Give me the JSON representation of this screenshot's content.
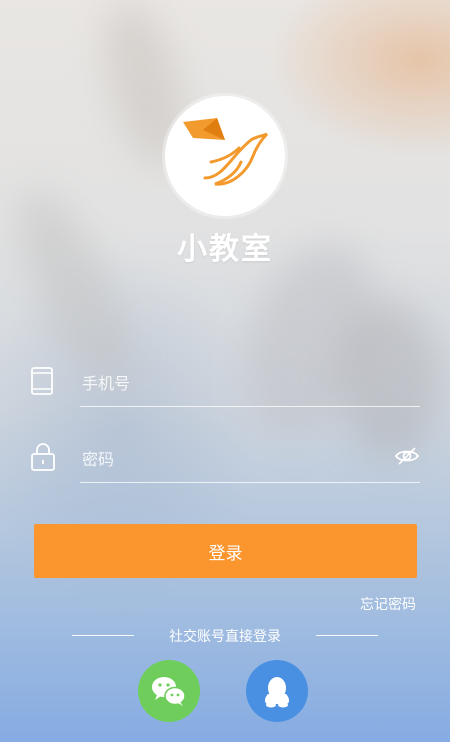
{
  "app": {
    "name": "小教室"
  },
  "form": {
    "phone_placeholder": "手机号",
    "password_placeholder": "密码",
    "login_label": "登录",
    "forgot_label": "忘记密码"
  },
  "social": {
    "label": "社交账号直接登录",
    "providers": [
      {
        "name": "wechat",
        "icon": "wechat-icon",
        "color": "#6fce5b"
      },
      {
        "name": "qq",
        "icon": "qq-icon",
        "color": "#4a90e2"
      }
    ]
  },
  "colors": {
    "accent": "#fb962f",
    "logo_orange": "#f39a2e"
  }
}
